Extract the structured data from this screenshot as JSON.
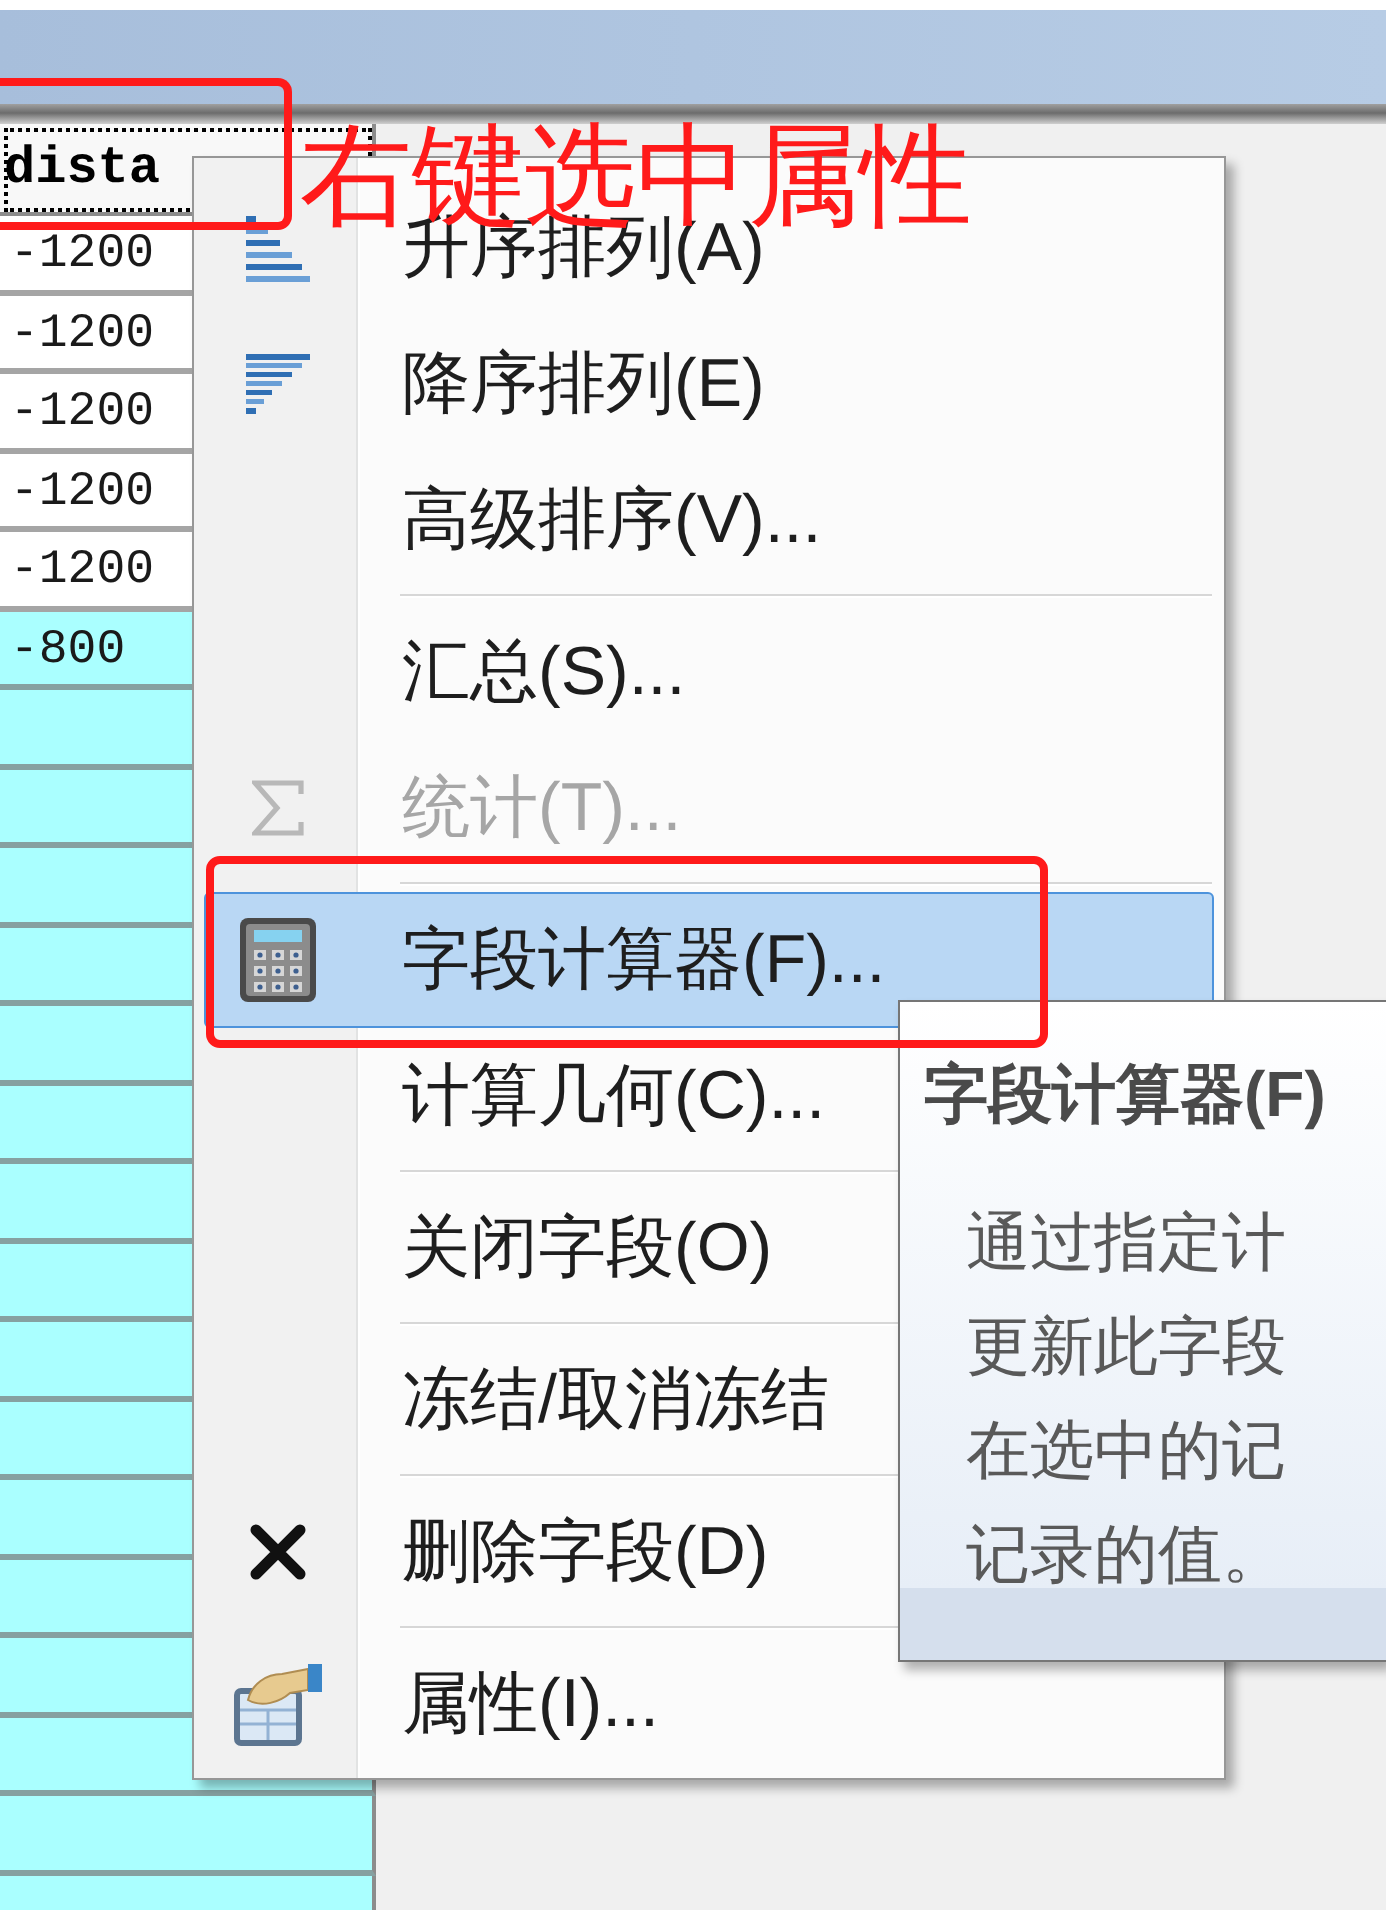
{
  "table": {
    "columns": [
      {
        "header": "dista",
        "selected": true
      }
    ],
    "rows": [
      {
        "cells": [
          "-1200"
        ],
        "selected": false
      },
      {
        "cells": [
          "-1200"
        ],
        "selected": false
      },
      {
        "cells": [
          "-1200"
        ],
        "selected": false
      },
      {
        "cells": [
          "-1200"
        ],
        "selected": false
      },
      {
        "cells": [
          "-1200"
        ],
        "selected": false
      },
      {
        "cells": [
          "-800"
        ],
        "selected": true
      },
      {
        "selected": true
      },
      {
        "selected": true
      },
      {
        "selected": true
      },
      {
        "selected": true
      },
      {
        "selected": true
      },
      {
        "selected": true
      },
      {
        "selected": true
      },
      {
        "selected": true
      },
      {
        "selected": true
      },
      {
        "selected": true
      },
      {
        "selected": true
      },
      {
        "selected": true
      },
      {
        "selected": true
      },
      {
        "selected": true
      },
      {
        "selected": true
      },
      {
        "selected": true
      }
    ]
  },
  "context_menu": {
    "groups": [
      {
        "items": [
          {
            "label": "升序排列(A)",
            "disabled": false,
            "highlighted": false
          },
          {
            "label": "降序排列(E)",
            "disabled": false,
            "highlighted": false
          },
          {
            "label": "高级排序(V)...",
            "disabled": false,
            "highlighted": false
          }
        ]
      },
      {
        "items": [
          {
            "label": "汇总(S)...",
            "disabled": false,
            "highlighted": false
          },
          {
            "label": "统计(T)...",
            "disabled": true,
            "highlighted": false
          }
        ]
      },
      {
        "items": [
          {
            "label": "字段计算器(F)...",
            "disabled": false,
            "highlighted": true
          },
          {
            "label": "计算几何(C)...",
            "disabled": false,
            "highlighted": false
          }
        ]
      },
      {
        "items": [
          {
            "label": "关闭字段(O)",
            "disabled": false,
            "highlighted": false
          }
        ]
      },
      {
        "items": [
          {
            "label": "冻结/取消冻结",
            "disabled": false,
            "highlighted": false
          }
        ]
      },
      {
        "items": [
          {
            "label": "删除字段(D)",
            "disabled": false,
            "highlighted": false
          }
        ]
      },
      {
        "items": [
          {
            "label": "属性(I)...",
            "disabled": false,
            "highlighted": false
          }
        ]
      }
    ]
  },
  "tooltip": {
    "title": "字段计算器(F)",
    "lines": [
      "通过指定计",
      "更新此字段",
      "在选中的记",
      "记录的值。"
    ]
  },
  "annotation": {
    "text": "右键选中属性"
  }
}
